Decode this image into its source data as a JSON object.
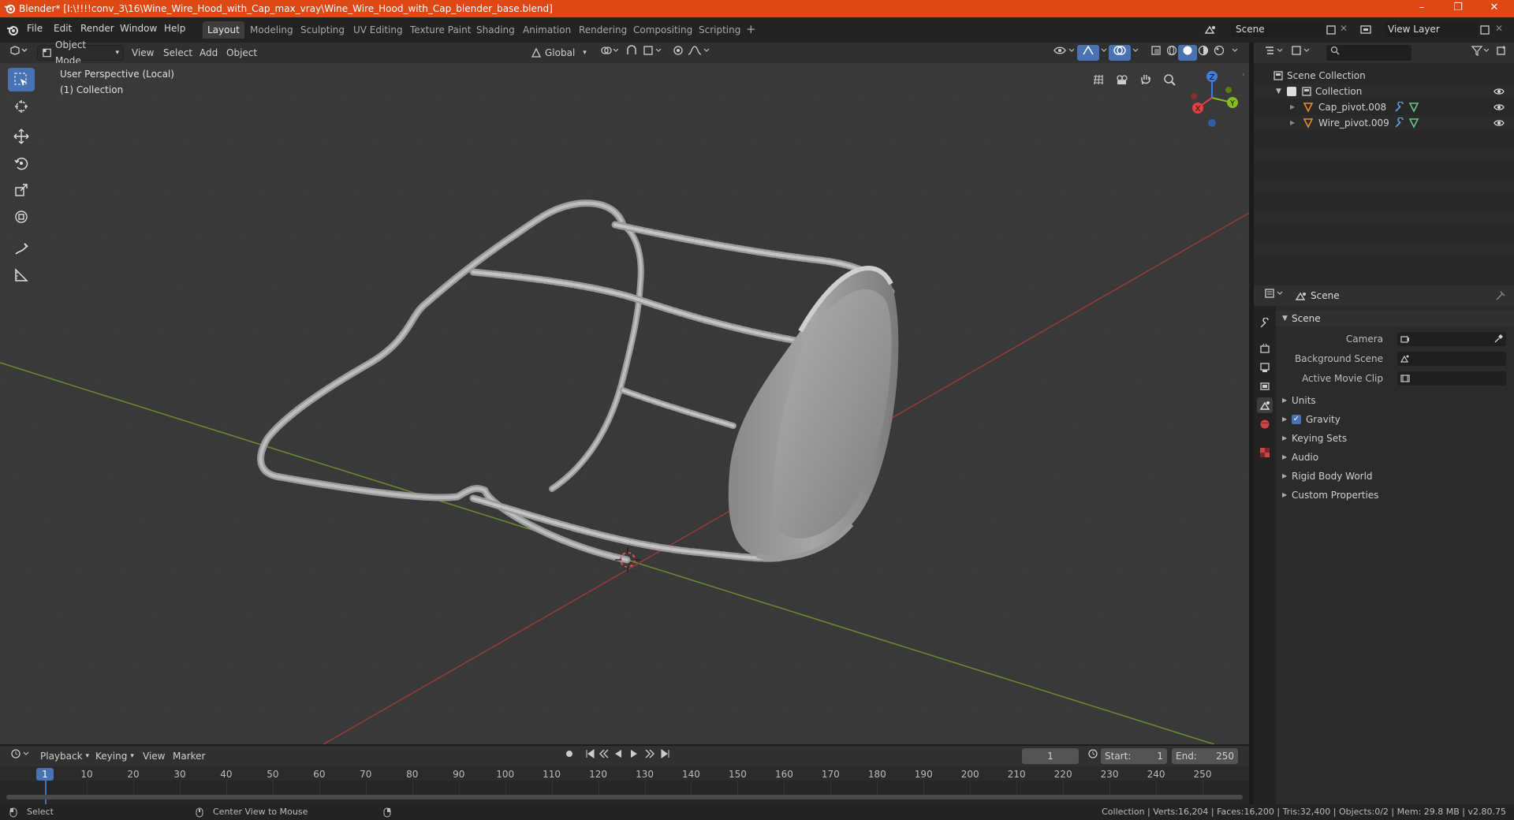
{
  "titlebar": {
    "title": "Blender* [I:\\!!!!conv_3\\16\\Wine_Wire_Hood_with_Cap_max_vray\\Wine_Wire_Hood_with_Cap_blender_base.blend]",
    "minimize": "–",
    "restore": "❐",
    "close": "✕"
  },
  "menu": [
    "File",
    "Edit",
    "Render",
    "Window",
    "Help"
  ],
  "workspaces": [
    "Layout",
    "Modeling",
    "Sculpting",
    "UV Editing",
    "Texture Paint",
    "Shading",
    "Animation",
    "Rendering",
    "Compositing",
    "Scripting"
  ],
  "active_workspace": "Layout",
  "add_workspace": "+",
  "scene_name": "Scene",
  "view_layer": "View Layer",
  "viewport_header": {
    "mode": "Object Mode",
    "menus": [
      "View",
      "Select",
      "Add",
      "Object"
    ],
    "orientation": "Global"
  },
  "viewport": {
    "perspective": "User Perspective (Local)",
    "collection": "(1) Collection",
    "gizmo": {
      "x": "X",
      "y": "Y",
      "z": "Z"
    }
  },
  "outliner": {
    "root": "Scene Collection",
    "collection": "Collection",
    "objects": [
      "Cap_pivot.008",
      "Wire_pivot.009"
    ]
  },
  "properties": {
    "context": "Scene",
    "panel": "Scene",
    "fields": [
      {
        "label": "Camera"
      },
      {
        "label": "Background Scene"
      },
      {
        "label": "Active Movie Clip"
      }
    ],
    "sections": [
      "Units",
      "Gravity",
      "Keying Sets",
      "Audio",
      "Rigid Body World",
      "Custom Properties"
    ],
    "gravity_checked": true
  },
  "timeline": {
    "menus": [
      "Playback",
      "Keying",
      "View",
      "Marker"
    ],
    "current_frame": "1",
    "start_label": "Start:",
    "start": "1",
    "end_label": "End:",
    "end": "250",
    "ticks": [
      "10",
      "20",
      "30",
      "40",
      "50",
      "60",
      "70",
      "80",
      "90",
      "100",
      "110",
      "120",
      "130",
      "140",
      "150",
      "160",
      "170",
      "180",
      "190",
      "200",
      "210",
      "220",
      "230",
      "240",
      "250"
    ],
    "playhead": "1"
  },
  "status": {
    "left_action": "Select",
    "mid_action": "Center View to Mouse",
    "stats": "Collection | Verts:16,204 | Faces:16,200 | Tris:32,400 | Objects:0/2 | Mem: 29.8 MB | v2.80.75"
  },
  "colors": {
    "titlebar": "#dd4814",
    "accent": "#4772b3",
    "x_axis": "#e0403f",
    "y_axis": "#86bc21",
    "z_axis": "#3f7de0"
  }
}
